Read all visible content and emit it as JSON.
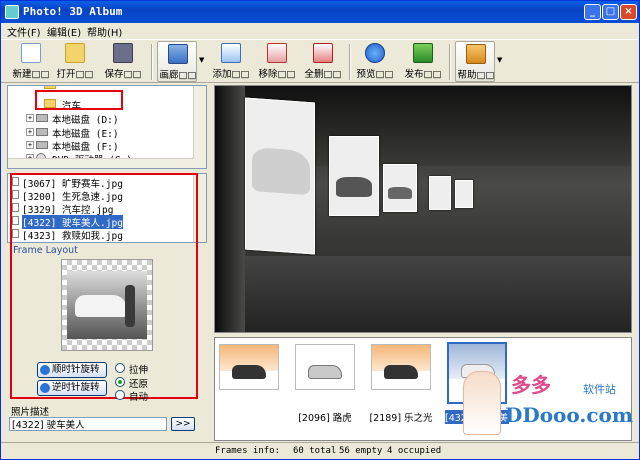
{
  "window": {
    "title": "Photo! 3D Album"
  },
  "menu": [
    "文件(F)",
    "编辑(E)",
    "帮助(H)"
  ],
  "toolbar": {
    "new": "新建□□",
    "open": "打开□□",
    "save": "保存□□",
    "frame": "画廊□□",
    "add": "添加□□",
    "remove": "移除□□",
    "removeall": "全删□□",
    "preview": "预览□□",
    "publish": "发布□□",
    "help": "帮助□□"
  },
  "tree": {
    "rows": [
      "汽车",
      "本地磁盘 (D:)",
      "本地磁盘 (E:)",
      "本地磁盘 (F:)",
      "DVD 驱动器 (G:)"
    ]
  },
  "files": {
    "items": [
      "[3067] 旷野赛车.jpg",
      "[3200] 生死急速.jpg",
      "[3329] 汽车控.jpg",
      "[4322] 驶车美人.jpg",
      "[4323] 救赎如我.jpg"
    ],
    "selected_index": 3
  },
  "frame_layout": {
    "label": "Frame Layout",
    "rotate_ccw": "顺时针旋转",
    "rotate_cw": "逆时针旋转",
    "options": [
      "拉伸",
      "还原",
      "自动"
    ],
    "selected_option": "还原"
  },
  "description": {
    "label": "照片描述",
    "value": "[4322] 驶车美人",
    "go": ">>"
  },
  "thumbnails": {
    "captions": [
      "",
      "[2096] 路虎",
      "[2189] 乐之光",
      "[4322] 驶车美人"
    ]
  },
  "watermark": {
    "brand": "多多",
    "tagline": "软件站",
    "url": "DDooo.com"
  },
  "status": {
    "frames_info": "Frames info:",
    "total": "60 total",
    "empty": "56 empty",
    "occupied": "4 occupied"
  }
}
